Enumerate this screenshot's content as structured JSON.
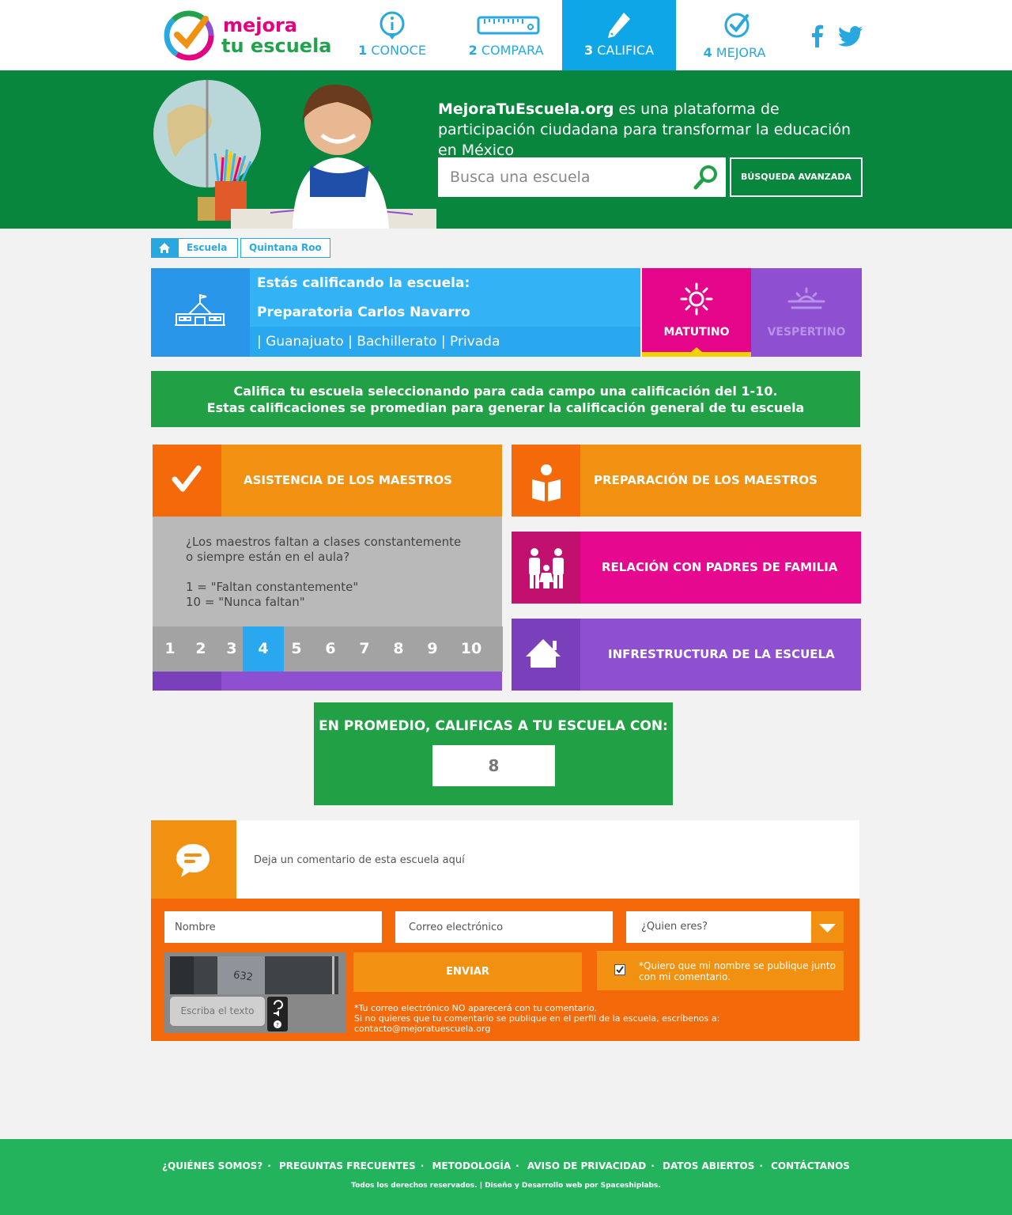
{
  "brand": {
    "logo_line1": "mejora",
    "logo_line2": "tu escuela"
  },
  "nav": [
    {
      "num": "1",
      "label": "CONOCE",
      "icon": "info-icon"
    },
    {
      "num": "2",
      "label": "COMPARA",
      "icon": "ruler-icon"
    },
    {
      "num": "3",
      "label": "CALIFICA",
      "icon": "pencil-icon"
    },
    {
      "num": "4",
      "label": "MEJORA",
      "icon": "check-circle-icon"
    }
  ],
  "social": {
    "facebook": "facebook-icon",
    "twitter": "twitter-icon"
  },
  "hero": {
    "brand": "MejoraTuEscuela.org",
    "text": " es una plataforma de participación ciudadana para transformar la educación en México",
    "search_placeholder": "Busca una escuela",
    "advanced_label": "BÚSQUEDA AVANZADA"
  },
  "breadcrumb": {
    "home_icon": "home-icon",
    "items": [
      "Escuela",
      "Quintana Roo"
    ]
  },
  "school": {
    "heading": "Estás calificando la escuela:",
    "name": "Preparatoria Carlos Navarro",
    "meta": "| Guanajuato | Bachillerato | Privada",
    "shift_am": "MATUTINO",
    "shift_pm": "VESPERTINO"
  },
  "instructions": {
    "line1_pre": "Califica tu escuela seleccionando para cada campo una calificación del ",
    "line1_bold": "1-10.",
    "line2": "Estas calificaciones se promedian para generar la calificación general de tu escuela"
  },
  "categories": [
    {
      "label": "ASISTENCIA DE LOS MAESTROS",
      "icon": "checkmark-icon"
    },
    {
      "label": "PREPARACIÓN DE LOS MAESTROS",
      "icon": "reader-icon"
    },
    {
      "label": "RELACIÓN CON PADRES DE FAMILIA",
      "icon": "family-icon"
    },
    {
      "label": "INFRESTRUCTURA DE LA ESCUELA",
      "icon": "house-icon"
    }
  ],
  "question": {
    "line1": "¿Los maestros faltan a clases constantemente",
    "line2": "o siempre están en el aula?",
    "scale1": "1 = \"Faltan constantemente\"",
    "scale10": "10 = \"Nunca faltan\""
  },
  "rating": {
    "options": [
      "1",
      "2",
      "3",
      "4",
      "5",
      "6",
      "7",
      "8",
      "9",
      "10"
    ],
    "selected": "4"
  },
  "average": {
    "label": "EN PROMEDIO, CALIFICAS A TU ESCUELA CON:",
    "value": "8"
  },
  "comment": {
    "prompt": "Deja un comentario de esta escuela aquí",
    "name_placeholder": "Nombre",
    "email_placeholder": "Correo electrónico",
    "who_placeholder": "¿Quien eres?",
    "captcha_placeholder": "Escriba el texto",
    "captcha_code": "632",
    "send_label": "ENVIAR",
    "publish_text": "*Quiero que mi nombre se publique junto con mi comentario.",
    "note1": "*Tu correo electrónico NO aparecerá con tu comentario.",
    "note2": "Si no quieres que tu comentario se publique en el perfil de la escuela, escríbenos a: contacto@mejoratuescuela.org"
  },
  "footer": {
    "links": [
      "¿QUIÉNES SOMOS?",
      "PREGUNTAS FRECUENTES",
      "METODOLOGÍA",
      "AVISO DE PRIVACIDAD",
      "DATOS ABIERTOS",
      "CONTÁCTANOS"
    ],
    "copyright": "Todos los derechos reservados. | Diseño y Desarrollo web por Spaceshiplabs."
  },
  "colors": {
    "header_active": "#0ea6e6",
    "hero_green": "#09863d",
    "orange": "#f29111",
    "magenta": "#e4058a",
    "purple": "#8e4fd1",
    "blue": "#33b3f5",
    "footer_green": "#23b35c"
  }
}
